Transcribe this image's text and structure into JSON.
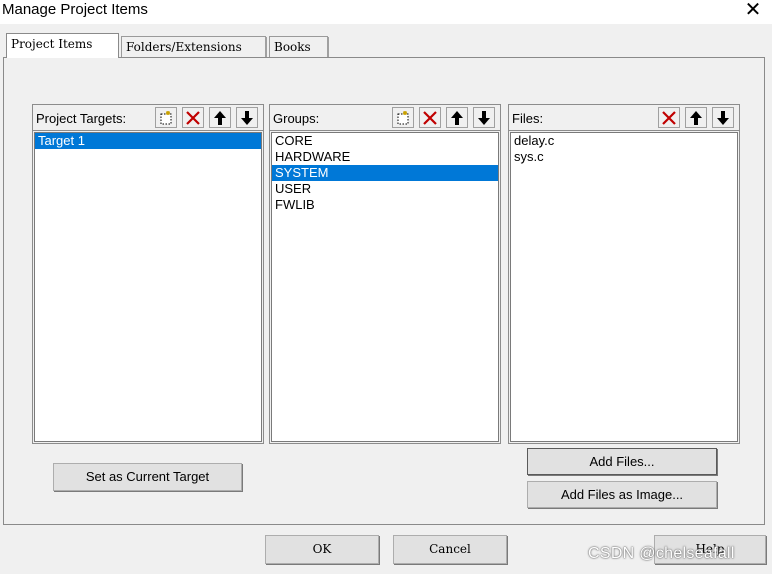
{
  "window": {
    "title": "Manage Project Items"
  },
  "tabs": [
    {
      "label": "Project Items",
      "active": true
    },
    {
      "label": "Folders/Extensions",
      "active": false
    },
    {
      "label": "Books",
      "active": false
    }
  ],
  "targets": {
    "label": "Project Targets:",
    "items": [
      "Target 1"
    ],
    "selected_index": 0
  },
  "groups": {
    "label": "Groups:",
    "items": [
      "CORE",
      "HARDWARE",
      "SYSTEM",
      "USER",
      "FWLIB"
    ],
    "selected_index": 2
  },
  "files": {
    "label": "Files:",
    "items": [
      "delay.c",
      "sys.c"
    ]
  },
  "buttons": {
    "set_current_target": "Set as Current Target",
    "add_files": "Add Files...",
    "add_files_image": "Add Files as Image...",
    "ok": "OK",
    "cancel": "Cancel",
    "help": "Help"
  },
  "watermark": "CSDN @chelseafall",
  "colors": {
    "selection": "#0078d7",
    "delete_red": "#c00000"
  },
  "icons": [
    "close-icon",
    "new-item-icon",
    "delete-icon",
    "move-up-icon",
    "move-down-icon"
  ]
}
